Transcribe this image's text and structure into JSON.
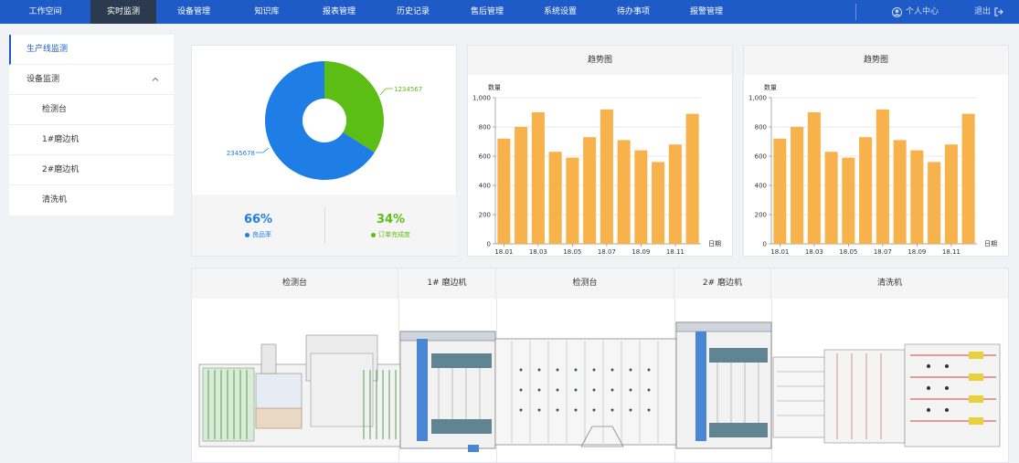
{
  "nav": {
    "items": [
      "工作空间",
      "实时监测",
      "设备管理",
      "知识库",
      "报表管理",
      "历史记录",
      "售后管理",
      "系统设置",
      "待办事项",
      "报警管理"
    ],
    "user_label": "个人中心",
    "logout_label": "退出"
  },
  "sidebar": {
    "items": [
      {
        "label": "生产线监测"
      },
      {
        "label": "设备监测"
      },
      {
        "label": "检测台"
      },
      {
        "label": "1#磨边机"
      },
      {
        "label": "2#磨边机"
      },
      {
        "label": "清洗机"
      }
    ]
  },
  "donut": {
    "good_label": "2345678",
    "order_label": "1234567",
    "kpis": [
      {
        "value": "66%",
        "label": "良品率",
        "color": "#1e7ee6"
      },
      {
        "value": "34%",
        "label": "订单完成度",
        "color": "#5cbd14"
      }
    ]
  },
  "chart_data": [
    {
      "type": "bar",
      "title": "趋势图",
      "ylabel": "数量",
      "xlabel": "日期",
      "categories": [
        "18.01",
        "18.02",
        "18.03",
        "18.04",
        "18.05",
        "18.06",
        "18.07",
        "18.08",
        "18.09",
        "18.10",
        "18.11",
        "18.12"
      ],
      "tick_labels": [
        "18.01",
        "18.03",
        "18.05",
        "18.07",
        "18.09",
        "18.11"
      ],
      "yticks": [
        "0",
        "200",
        "400",
        "600",
        "800",
        "1,000"
      ],
      "values": [
        720,
        800,
        900,
        630,
        590,
        730,
        920,
        710,
        640,
        560,
        680,
        890
      ],
      "ylim": [
        0,
        1000
      ],
      "color": "#f8b24c"
    },
    {
      "type": "bar",
      "title": "趋势图",
      "ylabel": "数量",
      "xlabel": "日期",
      "categories": [
        "18.01",
        "18.02",
        "18.03",
        "18.04",
        "18.05",
        "18.06",
        "18.07",
        "18.08",
        "18.09",
        "18.10",
        "18.11",
        "18.12"
      ],
      "tick_labels": [
        "18.01",
        "18.03",
        "18.05",
        "18.07",
        "18.09",
        "18.11"
      ],
      "yticks": [
        "0",
        "200",
        "400",
        "600",
        "800",
        "1,000"
      ],
      "values": [
        720,
        800,
        900,
        630,
        590,
        730,
        920,
        710,
        640,
        560,
        680,
        890
      ],
      "ylim": [
        0,
        1000
      ],
      "color": "#f8b24c"
    }
  ],
  "line": {
    "sections": [
      "检测台",
      "1# 磨边机",
      "检测台",
      "2# 磨边机",
      "清洗机"
    ]
  },
  "colors": {
    "brand": "#1f5bc7",
    "nav_active": "#2b3a4e",
    "donut_blue": "#1e7ee6",
    "donut_green": "#5cbd14",
    "bar": "#f8b24c"
  }
}
